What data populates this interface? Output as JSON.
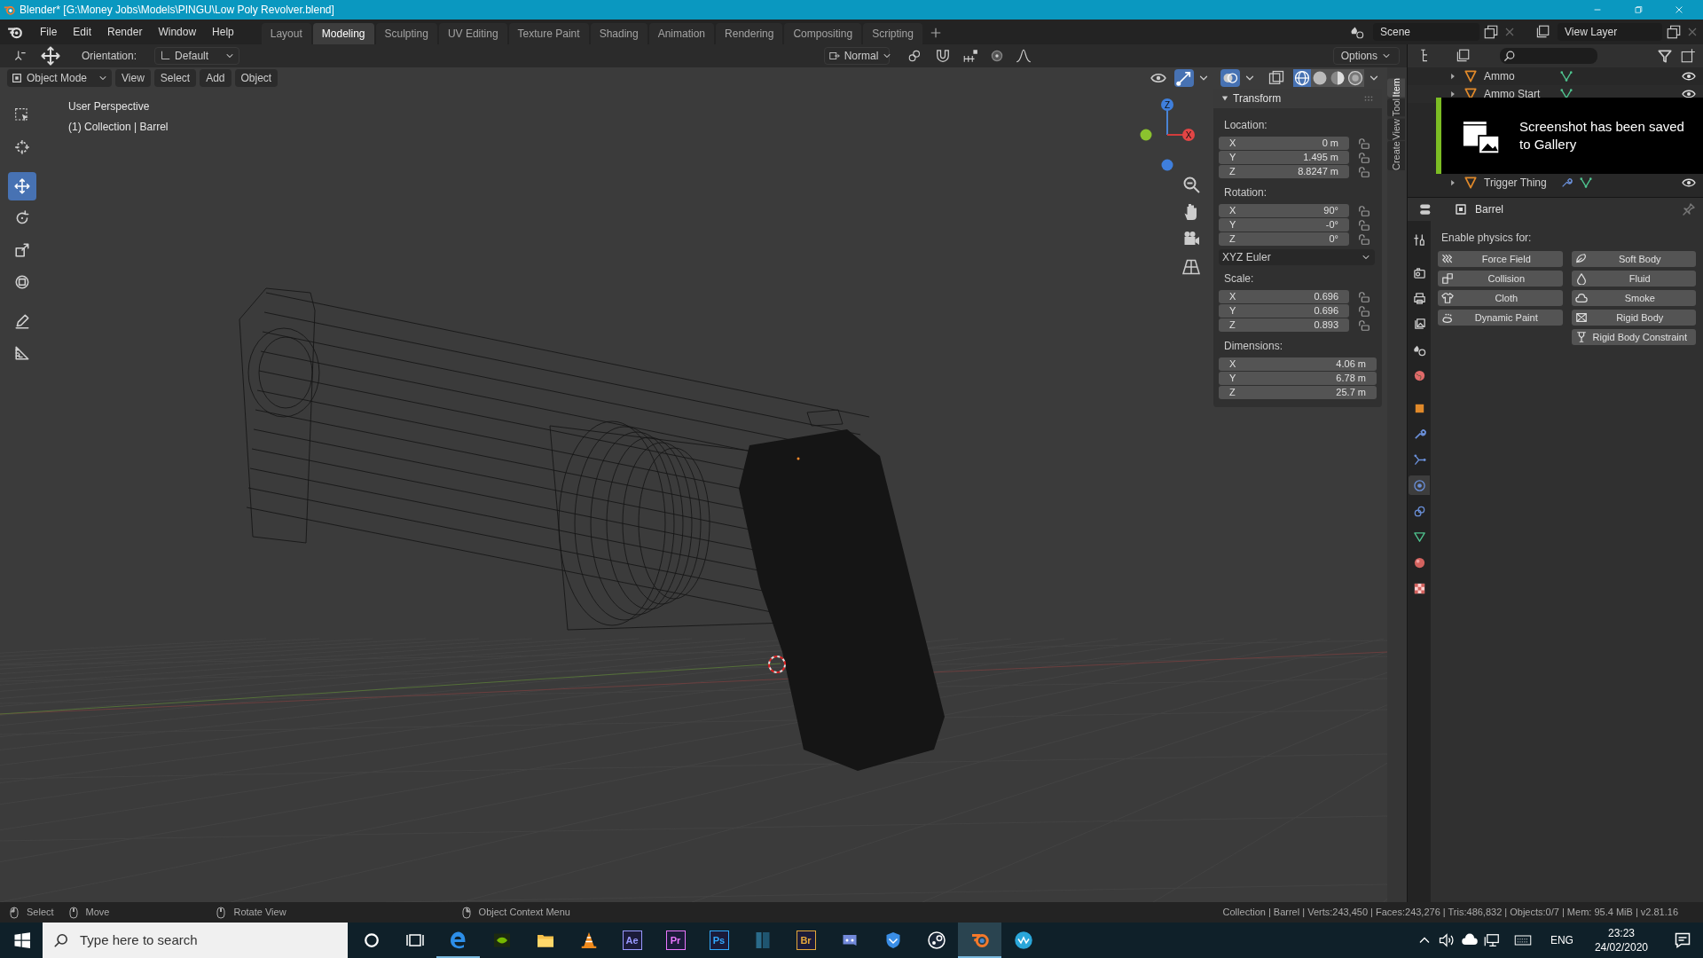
{
  "window": {
    "title": "Blender* [G:\\Money Jobs\\Models\\PINGU\\Low Poly Revolver.blend]"
  },
  "menu": [
    "File",
    "Edit",
    "Render",
    "Window",
    "Help"
  ],
  "workspaces": [
    {
      "label": "Layout",
      "selected": false
    },
    {
      "label": "Modeling",
      "selected": true
    },
    {
      "label": "Sculpting",
      "selected": false
    },
    {
      "label": "UV Editing",
      "selected": false
    },
    {
      "label": "Texture Paint",
      "selected": false
    },
    {
      "label": "Shading",
      "selected": false
    },
    {
      "label": "Animation",
      "selected": false
    },
    {
      "label": "Rendering",
      "selected": false
    },
    {
      "label": "Compositing",
      "selected": false
    },
    {
      "label": "Scripting",
      "selected": false
    }
  ],
  "scene": "Scene",
  "view_layer": "View Layer",
  "tool_header": {
    "orientation_label": "Orientation:",
    "orientation": "Default",
    "pivot": "Normal",
    "options": "Options"
  },
  "view_header": {
    "mode": "Object Mode",
    "menus": [
      "View",
      "Select",
      "Add",
      "Object"
    ],
    "shading": [
      {
        "kind": "wireframe",
        "selected": true
      },
      {
        "kind": "solid",
        "selected": false
      },
      {
        "kind": "material",
        "selected": false
      },
      {
        "kind": "rendered",
        "selected": false
      }
    ]
  },
  "viewport": {
    "perspective": "User Perspective",
    "collection": "(1) Collection | Barrel",
    "gizmo": [
      "Z",
      "X"
    ]
  },
  "tools": [
    {
      "kind": "select",
      "selected": false
    },
    {
      "kind": "cursor",
      "selected": false
    },
    {
      "kind": "move",
      "selected": true
    },
    {
      "kind": "rotate",
      "selected": false
    },
    {
      "kind": "scale",
      "selected": false
    },
    {
      "kind": "transform",
      "selected": false
    },
    {
      "kind": "annotate",
      "selected": false
    },
    {
      "kind": "measure",
      "selected": false
    }
  ],
  "sidebar_tabs": [
    {
      "label": "Item",
      "selected": true
    },
    {
      "label": "Tool",
      "selected": false
    },
    {
      "label": "View",
      "selected": false
    },
    {
      "label": "Create",
      "selected": false
    }
  ],
  "transform": {
    "title": "Transform",
    "sections": [
      {
        "kind": "vector",
        "label": "Location:",
        "lockable": true,
        "fields": [
          {
            "axis": "X",
            "value": "0 m"
          },
          {
            "axis": "Y",
            "value": "1.495 m"
          },
          {
            "axis": "Z",
            "value": "8.8247 m"
          }
        ]
      },
      {
        "kind": "vector",
        "label": "Rotation:",
        "lockable": true,
        "fields": [
          {
            "axis": "X",
            "value": "90°"
          },
          {
            "axis": "Y",
            "value": "-0°"
          },
          {
            "axis": "Z",
            "value": "0°"
          }
        ]
      },
      {
        "kind": "dropdown",
        "value": "XYZ Euler"
      },
      {
        "kind": "vector",
        "label": "Scale:",
        "lockable": true,
        "fields": [
          {
            "axis": "X",
            "value": "0.696"
          },
          {
            "axis": "Y",
            "value": "0.696"
          },
          {
            "axis": "Z",
            "value": "0.893"
          }
        ]
      },
      {
        "kind": "vector",
        "label": "Dimensions:",
        "lockable": false,
        "fields": [
          {
            "axis": "X",
            "value": "4.06 m"
          },
          {
            "axis": "Y",
            "value": "6.78 m"
          },
          {
            "axis": "Z",
            "value": "25.7 m"
          }
        ]
      }
    ]
  },
  "outliner": {
    "items": [
      {
        "label": "Ammo",
        "modifier": false
      },
      {
        "label": "Ammo Start",
        "modifier": false
      },
      {
        "label": "Trigger Thing",
        "modifier": true
      }
    ]
  },
  "notification": {
    "text": "Screenshot has been saved to Gallery"
  },
  "properties": {
    "object": "Barrel",
    "tabs": [
      {
        "kind": "tool",
        "selected": false
      },
      {
        "kind": "render",
        "selected": false
      },
      {
        "kind": "output",
        "selected": false
      },
      {
        "kind": "view_layer",
        "selected": false
      },
      {
        "kind": "scene",
        "selected": false
      },
      {
        "kind": "world",
        "selected": false
      },
      {
        "kind": "object",
        "selected": false
      },
      {
        "kind": "modifiers",
        "selected": false
      },
      {
        "kind": "particles",
        "selected": false
      },
      {
        "kind": "physics",
        "selected": true
      },
      {
        "kind": "constraints",
        "selected": false
      },
      {
        "kind": "data",
        "selected": false
      },
      {
        "kind": "material",
        "selected": false
      },
      {
        "kind": "texture",
        "selected": false
      }
    ],
    "heading": "Enable physics for:",
    "columns": [
      [
        {
          "kind": "force",
          "label": "Force Field"
        },
        {
          "kind": "collision",
          "label": "Collision"
        },
        {
          "kind": "cloth",
          "label": "Cloth"
        },
        {
          "kind": "paint",
          "label": "Dynamic Paint"
        }
      ],
      [
        {
          "kind": "softbody",
          "label": "Soft Body"
        },
        {
          "kind": "fluid",
          "label": "Fluid"
        },
        {
          "kind": "smoke",
          "label": "Smoke"
        },
        {
          "kind": "rigidbody",
          "label": "Rigid Body"
        },
        {
          "kind": "constraint",
          "label": "Rigid Body Constraint"
        }
      ]
    ]
  },
  "status_bar": {
    "hints": [
      {
        "kind": "left",
        "label": "Select"
      },
      {
        "kind": "middle",
        "label": "Move"
      },
      {
        "kind": "middle",
        "label": "Rotate View"
      },
      {
        "kind": "right",
        "label": "Object Context Menu"
      }
    ],
    "stats": "Collection | Barrel | Verts:243,450 | Faces:243,276 | Tris:486,832 | Objects:0/7 | Mem: 95.4 MiB | v2.81.16"
  },
  "taskbar": {
    "search_placeholder": "Type here to search",
    "apps": [
      {
        "kind": "cortana",
        "running": false,
        "selected": false
      },
      {
        "kind": "taskview",
        "running": false,
        "selected": false
      },
      {
        "kind": "edge",
        "running": true,
        "selected": false
      },
      {
        "kind": "gpu",
        "running": false,
        "selected": false
      },
      {
        "kind": "folder",
        "running": false,
        "selected": false
      },
      {
        "kind": "cone",
        "running": false,
        "selected": false
      },
      {
        "kind": "letters",
        "label": "Ae",
        "color": "#9999ff",
        "running": false,
        "selected": false
      },
      {
        "kind": "letters",
        "label": "Pr",
        "color": "#ea77ff",
        "running": false,
        "selected": false
      },
      {
        "kind": "letters",
        "label": "Ps",
        "color": "#31a8ff",
        "running": false,
        "selected": false
      },
      {
        "kind": "panels",
        "running": false,
        "selected": false
      },
      {
        "kind": "letters",
        "label": "Br",
        "color": "#e5a83b",
        "running": false,
        "selected": false
      },
      {
        "kind": "chat",
        "running": false,
        "selected": false
      },
      {
        "kind": "shield",
        "running": false,
        "selected": false
      },
      {
        "kind": "steam",
        "running": false,
        "selected": false
      },
      {
        "kind": "blender",
        "running": true,
        "selected": true
      },
      {
        "kind": "wave",
        "running": false,
        "selected": false
      }
    ],
    "language": "ENG",
    "time": "23:23",
    "date": "24/02/2020"
  }
}
